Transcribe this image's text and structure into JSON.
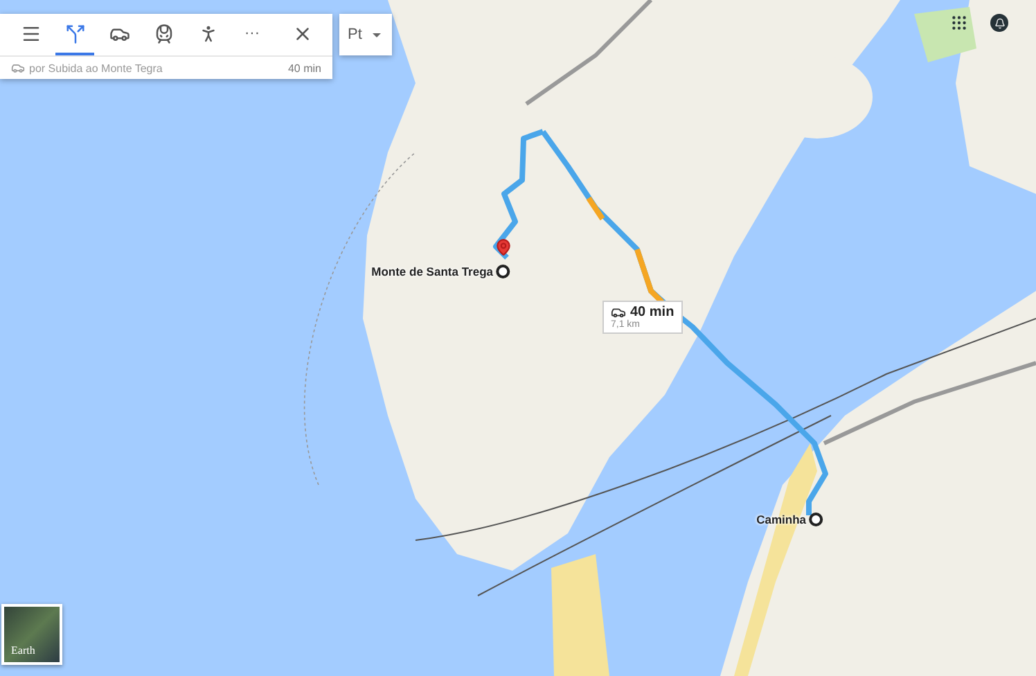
{
  "directions_panel": {
    "modes": [
      {
        "kind": "best",
        "selected": true
      },
      {
        "kind": "car",
        "selected": false
      },
      {
        "kind": "transit",
        "selected": false
      },
      {
        "kind": "walk",
        "selected": false
      },
      {
        "kind": "more",
        "label": "···",
        "selected": false
      }
    ],
    "route": {
      "via": "por Subida ao Monte Tegra",
      "duration": "40 min"
    }
  },
  "language": {
    "value": "Pt"
  },
  "route_callout": {
    "duration": "40 min",
    "distance": "7,1 km"
  },
  "places": [
    {
      "name": "Monte de Santa Trega",
      "kind": "destination"
    },
    {
      "name": "Caminha",
      "kind": "origin"
    }
  ],
  "earth_thumbnail": {
    "label": "Earth"
  }
}
